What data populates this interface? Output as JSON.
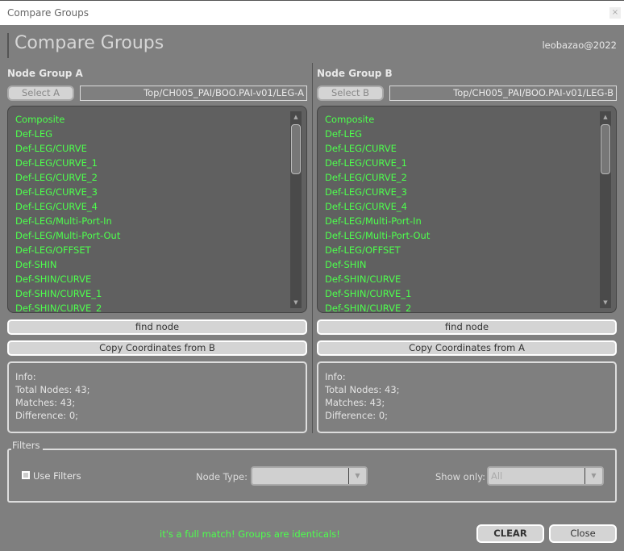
{
  "window": {
    "title": "Compare Groups",
    "close": "×"
  },
  "header": {
    "title": "Compare Groups",
    "user": "leobazao@2022"
  },
  "groupA": {
    "title": "Node Group A",
    "select_label": "Select A",
    "path": "Top/CH005_PAI/BOO.PAI-v01/LEG-A",
    "find_label": "find node",
    "copy_label": "Copy Coordinates from B",
    "info": {
      "title": "Info:",
      "total": "Total Nodes: 43;",
      "matches": "Matches: 43;",
      "difference": "Difference: 0;"
    }
  },
  "groupB": {
    "title": "Node Group B",
    "select_label": "Select B",
    "path": "Top/CH005_PAI/BOO.PAI-v01/LEG-B",
    "find_label": "find node",
    "copy_label": "Copy Coordinates from A",
    "info": {
      "title": "Info:",
      "total": "Total Nodes: 43;",
      "matches": "Matches: 43;",
      "difference": "Difference: 0;"
    }
  },
  "nodes": [
    "Composite",
    "Def-LEG",
    "Def-LEG/CURVE",
    "Def-LEG/CURVE_1",
    "Def-LEG/CURVE_2",
    "Def-LEG/CURVE_3",
    "Def-LEG/CURVE_4",
    "Def-LEG/Multi-Port-In",
    "Def-LEG/Multi-Port-Out",
    "Def-LEG/OFFSET",
    "Def-SHIN",
    "Def-SHIN/CURVE",
    "Def-SHIN/CURVE_1",
    "Def-SHIN/CURVE_2"
  ],
  "filters": {
    "title": "Filters",
    "use_filters": "Use Filters",
    "node_type_label": "Node Type:",
    "node_type_value": "",
    "show_only_label": "Show only:",
    "show_only_value": "All"
  },
  "status": "it's a full match! Groups are identicals!",
  "buttons": {
    "clear": "CLEAR",
    "close": "Close"
  },
  "colors": {
    "match": "#4dff4d",
    "background": "#7f7f7f"
  }
}
